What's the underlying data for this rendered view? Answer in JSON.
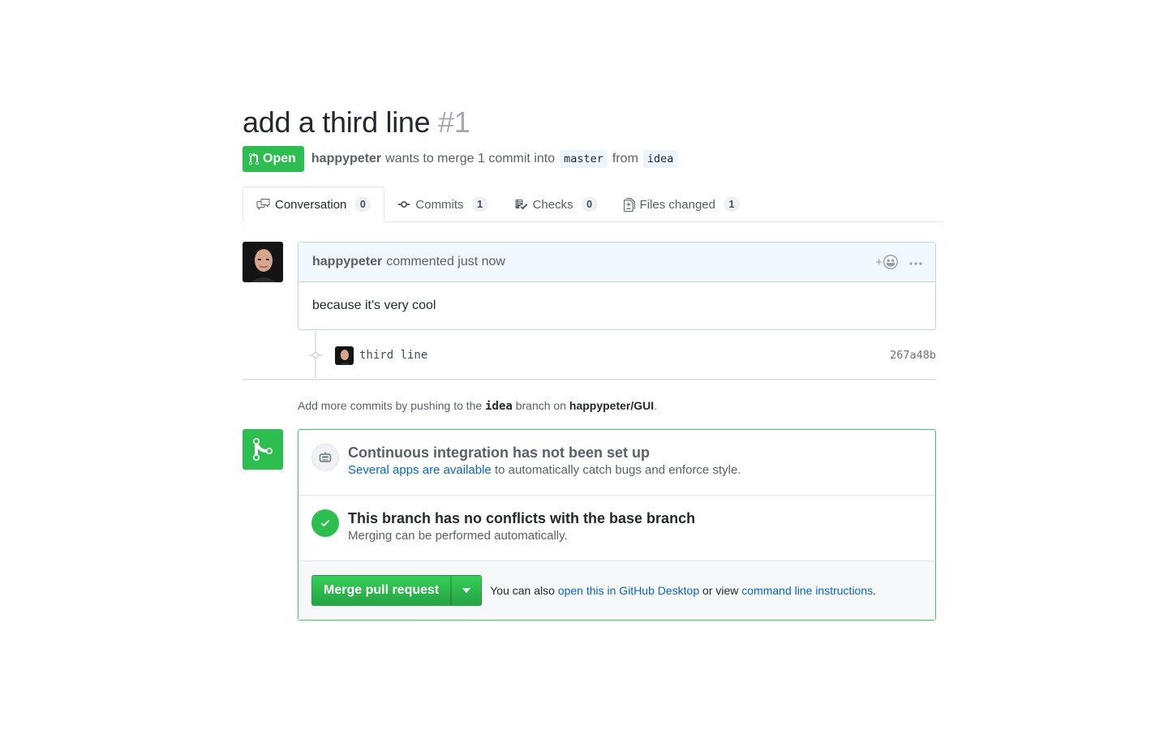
{
  "pr": {
    "title": "add a third line",
    "number": "#1",
    "state_label": "Open",
    "author": "happypeter",
    "merge_text": "wants to merge 1 commit into",
    "base_branch": "master",
    "from_word": "from",
    "head_branch": "idea"
  },
  "tabs": [
    {
      "label": "Conversation",
      "count": "0",
      "icon": "comment-discussion-icon"
    },
    {
      "label": "Commits",
      "count": "1",
      "icon": "git-commit-icon"
    },
    {
      "label": "Checks",
      "count": "0",
      "icon": "checklist-icon"
    },
    {
      "label": "Files changed",
      "count": "1",
      "icon": "file-diff-icon"
    }
  ],
  "comment": {
    "author": "happypeter",
    "meta": "commented just now",
    "body": "because it's very cool",
    "reaction_label": "+"
  },
  "commit": {
    "message": "third line",
    "sha": "267a48b"
  },
  "hint": {
    "prefix": "Add more commits by pushing to the",
    "branch": "idea",
    "middle": "branch on",
    "repo": "happypeter/GUI",
    "suffix": "."
  },
  "merge": {
    "ci_title": "Continuous integration has not been set up",
    "ci_link": "Several apps are available",
    "ci_rest": "to automatically catch bugs and enforce style.",
    "conflict_title": "This branch has no conflicts with the base branch",
    "conflict_desc": "Merging can be performed automatically.",
    "button_label": "Merge pull request",
    "also_prefix": "You can also",
    "desktop_link": "open this in GitHub Desktop",
    "also_middle": "or view",
    "cli_link": "command line instructions",
    "also_suffix": "."
  },
  "colors": {
    "green": "#2cbe4e",
    "link": "#0366d6"
  }
}
